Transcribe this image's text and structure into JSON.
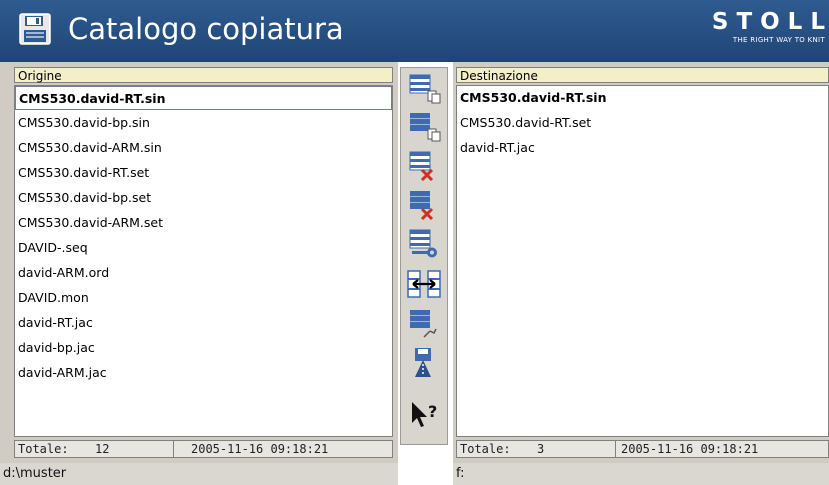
{
  "window": {
    "title": "Catalogo copiatura",
    "brand": "STOLL",
    "brand_tagline": "THE RIGHT WAY TO KNIT",
    "title_icon": "floppy-disk-icon"
  },
  "source": {
    "header": "Origine",
    "items": [
      {
        "name": "CMS530.david-RT.sin",
        "selected": true
      },
      {
        "name": "CMS530.david-bp.sin"
      },
      {
        "name": "CMS530.david-ARM.sin"
      },
      {
        "name": "CMS530.david-RT.set"
      },
      {
        "name": "CMS530.david-bp.set"
      },
      {
        "name": "CMS530.david-ARM.set"
      },
      {
        "name": "DAVID-.seq"
      },
      {
        "name": "david-ARM.ord"
      },
      {
        "name": "DAVID.mon"
      },
      {
        "name": "david-RT.jac"
      },
      {
        "name": "david-bp.jac"
      },
      {
        "name": "david-ARM.jac"
      }
    ],
    "total_label": "Totale:",
    "total_count": "12",
    "timestamp": "2005-11-16 09:18:21",
    "path": "d:\\muster"
  },
  "destination": {
    "header": "Destinazione",
    "items": [
      {
        "name": "CMS530.david-RT.sin",
        "selected": true
      },
      {
        "name": "CMS530.david-RT.set"
      },
      {
        "name": "david-RT.jac"
      }
    ],
    "total_label": "Totale:",
    "total_count": "3",
    "timestamp": "2005-11-16 09:18:21",
    "path": "f:"
  },
  "toolbar": [
    {
      "icon": "copy-selected-icon"
    },
    {
      "icon": "copy-all-icon"
    },
    {
      "icon": "delete-selected-icon"
    },
    {
      "icon": "delete-all-icon"
    },
    {
      "icon": "key-lock-icon"
    },
    {
      "icon": "swap-directions-icon"
    },
    {
      "icon": "edit-list-icon"
    },
    {
      "icon": "save-to-disk-icon"
    },
    {
      "icon": "help-pointer-icon"
    }
  ],
  "colors": {
    "title_bar": "#2a5488",
    "panel_bg": "#d0ccc4",
    "header_bg": "#f3efc8",
    "toolbar_blue": "#3d6ab0",
    "delete_red": "#d03020"
  }
}
